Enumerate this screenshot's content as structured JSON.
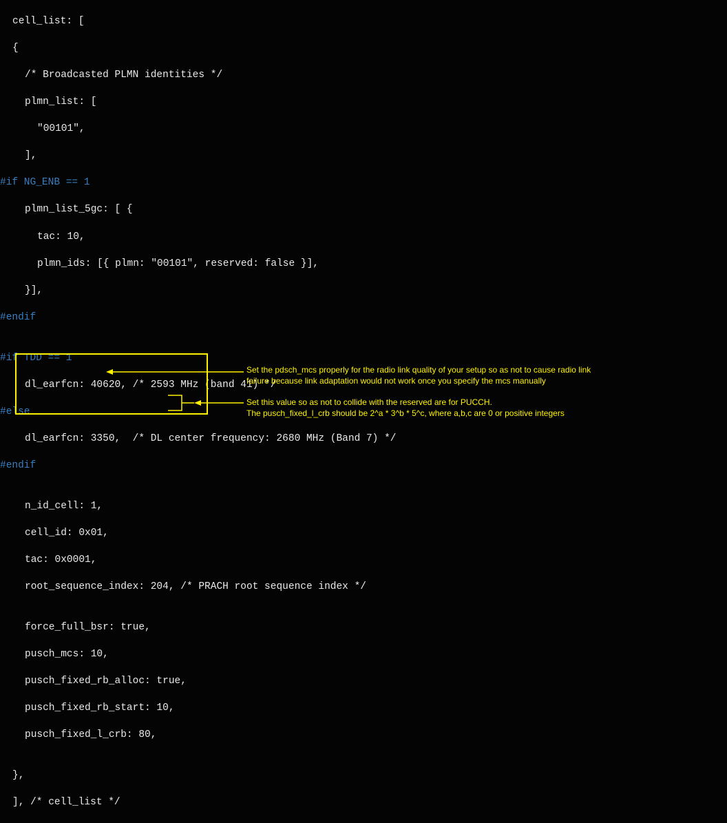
{
  "code": {
    "l01": "cell_list: [",
    "l02": "{",
    "l03": "/* Broadcasted PLMN identities */",
    "l04": "plmn_list: [",
    "l05": "\"00101\",",
    "l06": "],",
    "l07": "#if NG_ENB == 1",
    "l08": "plmn_list_5gc: [ {",
    "l09": "tac: 10,",
    "l10": "plmn_ids: [{ plmn: \"00101\", reserved: false }],",
    "l11": "}],",
    "l12": "#endif",
    "l13": "",
    "l14": "#if TDD == 1",
    "l15": "dl_earfcn: 40620, /* 2593 MHz (band 41) */",
    "l16": "#else",
    "l17": "dl_earfcn: 3350,  /* DL center frequency: 2680 MHz (Band 7) */",
    "l18": "#endif",
    "l19": "",
    "l20": "n_id_cell: 1,",
    "l21": "cell_id: 0x01,",
    "l22": "tac: 0x0001,",
    "l23": "root_sequence_index: 204, /* PRACH root sequence index */",
    "l24": "",
    "l25": "force_full_bsr: true,",
    "l26": "pusch_mcs: 10,",
    "l27": "pusch_fixed_rb_alloc: true,",
    "l28": "pusch_fixed_rb_start: 10,",
    "l29": "pusch_fixed_l_crb: 80,",
    "l30": "",
    "l31": "},",
    "l32": "], /* cell_list */"
  },
  "annotations": {
    "a1_line1": "Set the pdsch_mcs properly for the radio link quality of your setup so as not to cause radio link",
    "a1_line2": "failure because link adaptation would not work once you specify the mcs manually",
    "a2_line1": "Set this value so as not to collide with the reserved are for PUCCH.",
    "a2_line2": "The pusch_fixed_l_crb should be 2^a * 3^b * 5^c, where a,b,c are 0 or positive integers"
  }
}
